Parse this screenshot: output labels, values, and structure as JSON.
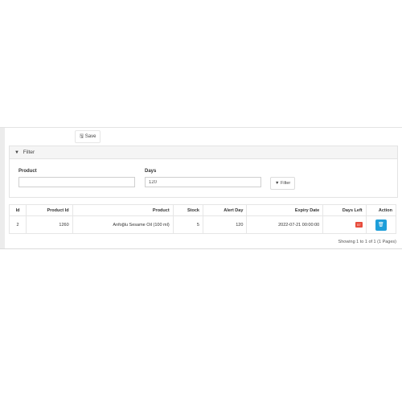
{
  "toolbar": {
    "save_label": "Save",
    "save_icon": "floppy-icon"
  },
  "filter": {
    "title": "Filter",
    "product_label": "Product",
    "product_value": "",
    "days_label": "Days",
    "days_value": "120",
    "button_label": "Filter"
  },
  "table": {
    "headers": [
      "Id",
      "Product Id",
      "Product",
      "Stock",
      "Alert Day",
      "Expiry Date",
      "Days Left",
      "Action"
    ],
    "rows": [
      {
        "id": "2",
        "product_id": "1260",
        "product": "Anfoğlu Sesame Oil (100 ml)",
        "stock": "5",
        "alert_day": "120",
        "expiry_date": "2022-07-21 00:00:00",
        "days_left": "57"
      }
    ]
  },
  "pagination": {
    "text": "Showing 1 to 1 of 1 (1 Pages)"
  },
  "colors": {
    "accent": "#1e9ed9",
    "danger": "#e74c3c"
  }
}
